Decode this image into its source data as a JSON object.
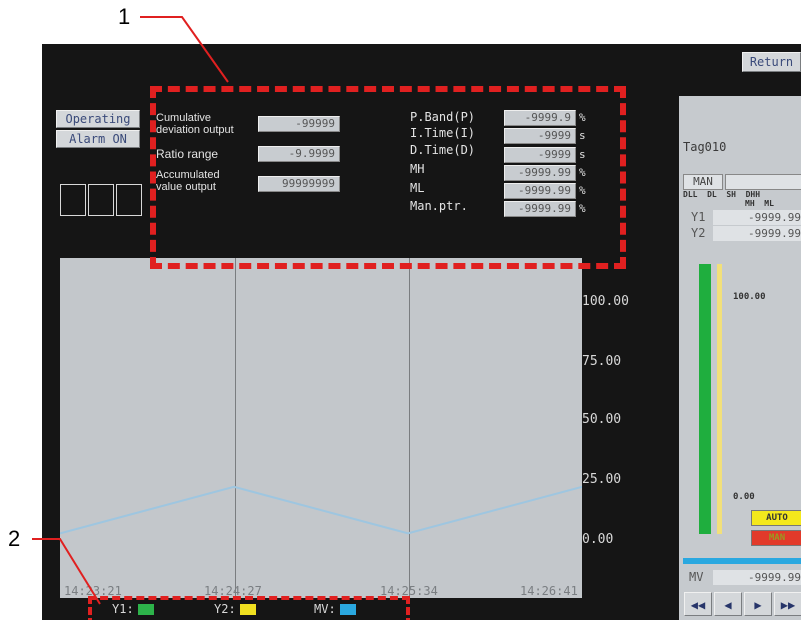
{
  "callouts": {
    "one": "1",
    "two": "2"
  },
  "header": {
    "return_label": "Return"
  },
  "status": {
    "operating": "Operating",
    "alarm": "Alarm ON"
  },
  "outputs": {
    "cumulative_label": "Cumulative\ndeviation output",
    "cumulative_value": "-99999",
    "ratio_label": "Ratio range",
    "ratio_value": "-9.9999",
    "accumulated_label": "Accumulated\nvalue output",
    "accumulated_value": "99999999"
  },
  "params": [
    {
      "label": "P.Band(P)",
      "value": "-9999.9",
      "unit": "%"
    },
    {
      "label": "I.Time(I)",
      "value": "-9999",
      "unit": "s"
    },
    {
      "label": "D.Time(D)",
      "value": "-9999",
      "unit": "s"
    },
    {
      "label": "MH",
      "value": "-9999.99",
      "unit": "%"
    },
    {
      "label": "ML",
      "value": "-9999.99",
      "unit": "%"
    },
    {
      "label": "Man.ptr.",
      "value": "-9999.99",
      "unit": "%"
    }
  ],
  "chart_data": {
    "type": "line",
    "x": [
      "14:23:21",
      "14:24:27",
      "14:25:34",
      "14:26:41"
    ],
    "yticks": [
      "100.00",
      "75.00",
      "50.00",
      "25.00",
      "0.00"
    ],
    "ylim": [
      0,
      100
    ],
    "series": [
      {
        "name": "MV",
        "color": "#9ec6e0",
        "values": [
          -12,
          10,
          -12,
          10
        ]
      }
    ]
  },
  "legend": [
    {
      "label": "Y1:",
      "color": "#2db34a"
    },
    {
      "label": "Y2:",
      "color": "#f0e020"
    },
    {
      "label": "MV:",
      "color": "#2aa8e0"
    }
  ],
  "side": {
    "tag": "Tag010",
    "mode": "MAN",
    "header_row": "DLL  DL  SH  DHH",
    "sub_row": "MH  ML",
    "y1_label": "Y1",
    "y1_value": "-9999.99",
    "y2_label": "Y2",
    "y2_value": "-9999.99",
    "scale_top": "100.00",
    "scale_bottom": "0.00",
    "auto_label": "AUTO",
    "man_label": "MAN",
    "mv_label": "MV",
    "mv_value": "-9999.99",
    "nav": [
      "◀◀",
      "◀",
      "▶",
      "▶▶"
    ]
  }
}
